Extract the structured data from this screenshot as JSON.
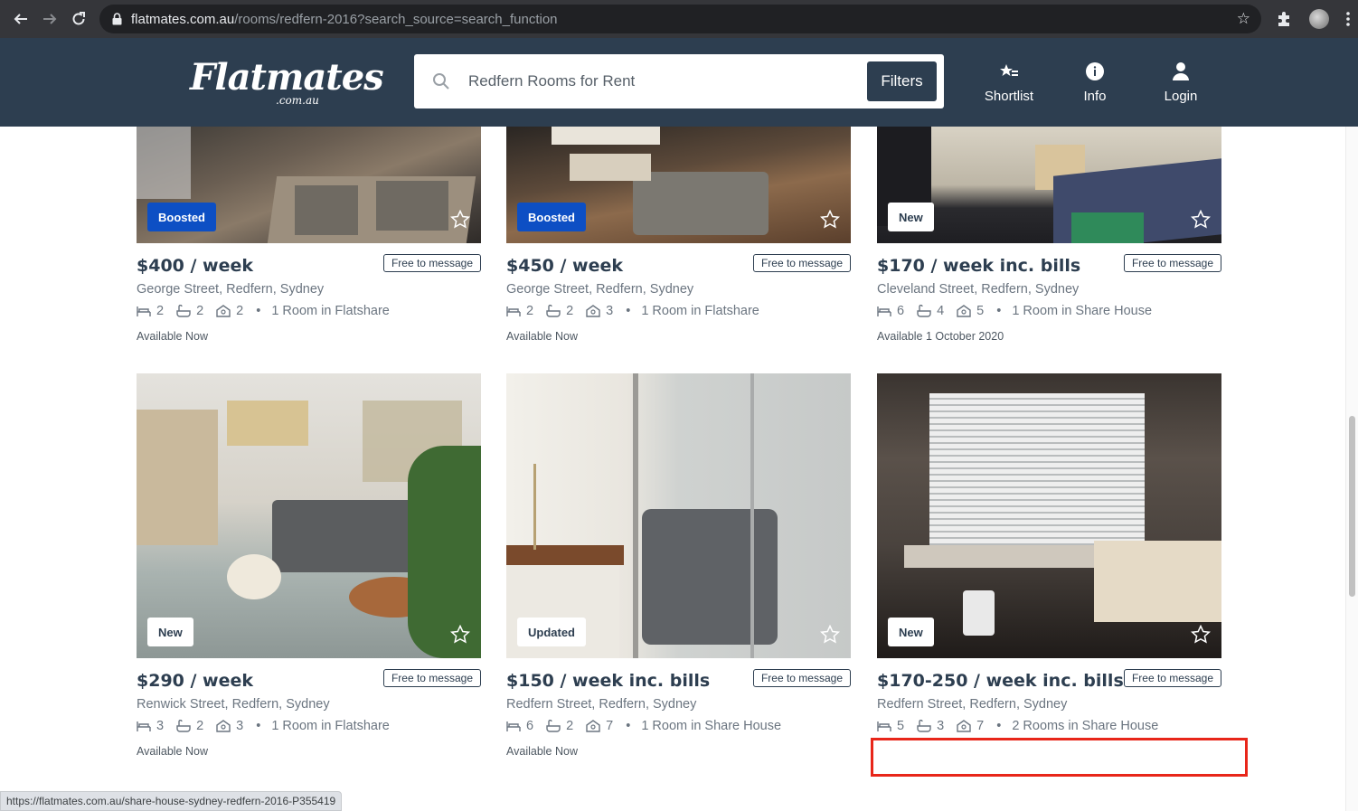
{
  "browser": {
    "url_domain": "flatmates.com.au",
    "url_path": "/rooms/redfern-2016?search_source=search_function",
    "status_url": "https://flatmates.com.au/share-house-sydney-redfern-2016-P355419"
  },
  "header": {
    "logo_main": "Flatmates",
    "logo_sub": ".com.au",
    "search_text": "Redfern Rooms for Rent",
    "filters_label": "Filters",
    "shortlist_label": "Shortlist",
    "info_label": "Info",
    "login_label": "Login"
  },
  "listings": [
    {
      "badge": "Boosted",
      "price": "$400 / week",
      "message": "Free to message",
      "address": "George Street, Redfern, Sydney",
      "beds": "2",
      "baths": "2",
      "people": "2",
      "type": "1 Room in Flatshare",
      "availability": "Available Now"
    },
    {
      "badge": "Boosted",
      "price": "$450 / week",
      "message": "Free to message",
      "address": "George Street, Redfern, Sydney",
      "beds": "2",
      "baths": "2",
      "people": "3",
      "type": "1 Room in Flatshare",
      "availability": "Available Now"
    },
    {
      "badge": "New",
      "price": "$170 / week inc. bills",
      "message": "Free to message",
      "address": "Cleveland Street, Redfern, Sydney",
      "beds": "6",
      "baths": "4",
      "people": "5",
      "type": "1 Room in Share House",
      "availability": "Available 1 October 2020"
    },
    {
      "badge": "New",
      "price": "$290 / week",
      "message": "Free to message",
      "address": "Renwick Street, Redfern, Sydney",
      "beds": "3",
      "baths": "2",
      "people": "3",
      "type": "1 Room in Flatshare",
      "availability": "Available Now"
    },
    {
      "badge": "Updated",
      "price": "$150 / week inc. bills",
      "message": "Free to message",
      "address": "Redfern Street, Redfern, Sydney",
      "beds": "6",
      "baths": "2",
      "people": "7",
      "type": "1 Room in Share House",
      "availability": "Available Now"
    },
    {
      "badge": "New",
      "price": "$170-250 / week inc. bills",
      "message": "Free to message",
      "address": "Redfern Street, Redfern, Sydney",
      "beds": "5",
      "baths": "3",
      "people": "7",
      "type": "2 Rooms in Share House",
      "availability": ""
    }
  ],
  "colors": {
    "header_bg": "#2d3e50",
    "boosted_badge": "#0d4fc4",
    "highlight": "#e8261a"
  }
}
